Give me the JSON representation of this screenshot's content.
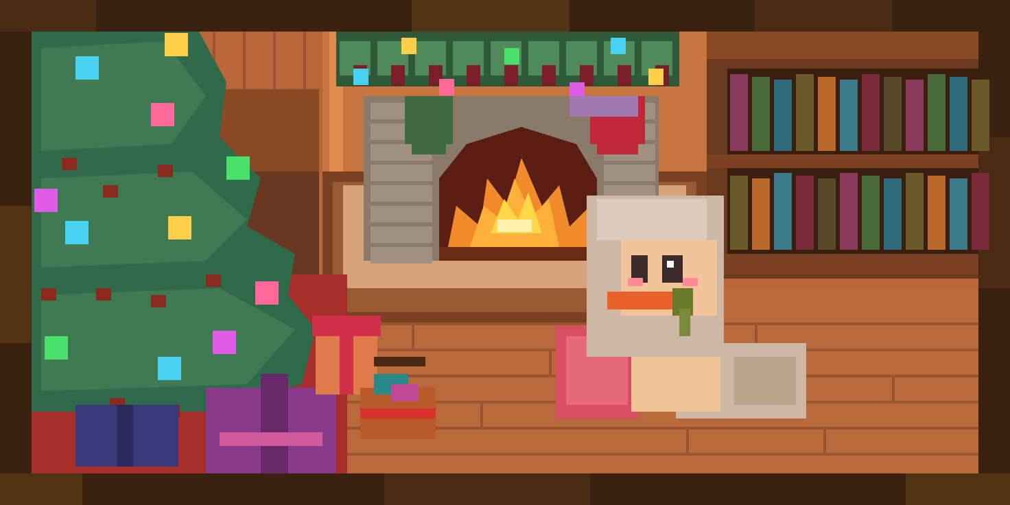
{
  "scene": {
    "kind": "pixel-art cozy holiday room",
    "colors": {
      "frame_dark": "#3b2210",
      "frame_mid": "#5a3a1a",
      "wall_wood": "#b8663a",
      "wall_wood_light": "#d07c46",
      "floor_wood": "#b86a3c",
      "floor_wood_dark": "#9a5430",
      "tree_green": "#2f6a4a",
      "tree_green_light": "#4f8a5a",
      "fire_orange": "#f08a2a",
      "fire_yellow": "#ffd84a",
      "stone": "#8a7a6a",
      "shelf_wood": "#6a3a1e",
      "pony_coat": "#f3c49a",
      "pony_mane": "#cdb8a6",
      "pillow_pink": "#d84e62",
      "gift_purple": "#8a3a8a",
      "gift_blue": "#3a3a7a",
      "stocking_red": "#c0283a",
      "carrot_orange": "#e8602a"
    },
    "icons": {
      "tree": "christmas-tree-icon",
      "fire": "fireplace-icon",
      "pony": "pony-character-icon",
      "gift": "gift-box-icon",
      "basket": "basket-icon",
      "bookshelf": "bookshelf-icon",
      "stocking": "stocking-icon",
      "garland": "garland-icon"
    },
    "ornament_colors": [
      "#4ad0f0",
      "#ffcf4a",
      "#ff6a9a",
      "#4ae06a",
      "#e05ae8"
    ],
    "book_colors": [
      "#8a3a5a",
      "#4a6a3a",
      "#2f6a7a",
      "#6a5a2a",
      "#b8662a",
      "#3a7a8a",
      "#7a2a3a",
      "#5a4a2a"
    ]
  }
}
